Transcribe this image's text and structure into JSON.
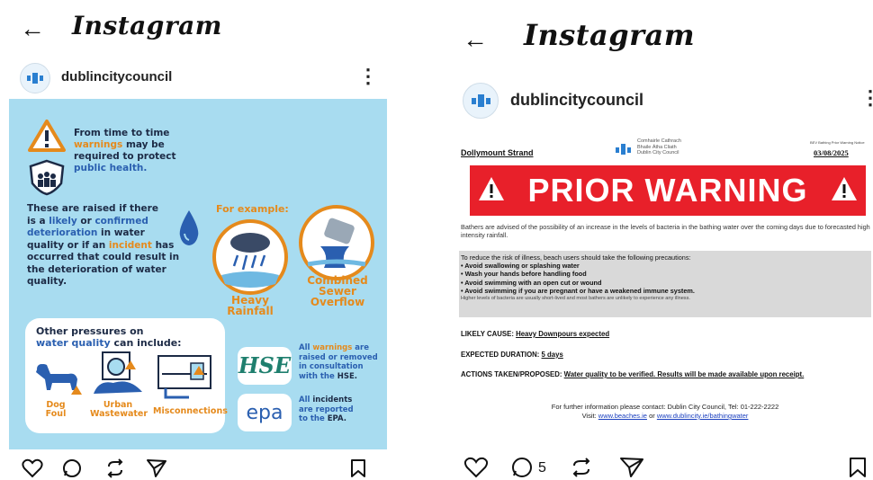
{
  "left": {
    "header": {
      "title": "Instagram"
    },
    "account": {
      "username": "dublincitycouncil"
    },
    "infographic": {
      "intro_a": "From time to time",
      "intro_warnings": "warnings",
      "intro_b": "may be",
      "intro_c": "required to protect",
      "intro_health": "public health.",
      "raised_1": "These are raised if there",
      "raised_2a": "is a",
      "raised_likely": "likely",
      "raised_or": "or",
      "raised_confirmed": "confirmed",
      "raised_deterioration": "deterioration",
      "raised_3b": "in water",
      "raised_4a": "quality or if an",
      "raised_incident": "incident",
      "raised_4b": "has",
      "raised_5": "occurred that could result in",
      "raised_6": "the deterioration of water",
      "raised_7": "quality.",
      "for_example": "For example:",
      "heavy_1": "Heavy",
      "heavy_2": "Rainfall",
      "sewer_1": "Combined",
      "sewer_2": "Sewer",
      "sewer_3": "Overflow",
      "other_1": "Other pressures on",
      "other_water": "water quality",
      "other_2": "can include:",
      "dog_1": "Dog",
      "dog_2": "Foul",
      "urban_1": "Urban",
      "urban_2": "Wastewater",
      "misconn": "Misconnections",
      "hse_logo": "HSE",
      "hse_1": "All",
      "hse_warnings": "warnings",
      "hse_1b": "are",
      "hse_2": "raised or removed",
      "hse_3": "in consultation",
      "hse_4a": "with the",
      "hse_4b": "HSE.",
      "epa_logo": "epa",
      "epa_1": "All",
      "epa_incidents": "incidents",
      "epa_2": "are reported",
      "epa_3a": "to the",
      "epa_3b": "EPA."
    }
  },
  "right": {
    "header": {
      "title": "Instagram"
    },
    "account": {
      "username": "dublincitycouncil"
    },
    "notice": {
      "location": "Dollymount Strand",
      "council_1": "Comhairle Cathrach",
      "council_2": "Bhaile Átha Cliath",
      "council_3": "Dublin City Council",
      "doc_type": "BEV Bathing Prior Warning Notice",
      "date": "03/08/2025",
      "banner": "PRIOR WARNING",
      "advice": "Bathers are advised of the possibility of an increase in the levels of bacteria in the bathing water over the coming days due to forecasted high intensity rainfall.",
      "reduce_intro": "To reduce the risk of illness, beach users should take the following precautions:",
      "precautions": [
        "• Avoid swallowing or splashing water",
        "• Wash your hands before handling food",
        "• Avoid swimming with an open cut or wound",
        "• Avoid swimming if you are pregnant or have a weakened immune system."
      ],
      "bacteria_note": "Higher levels of bacteria are usually short-lived and most bathers are unlikely to experience any illness.",
      "cause_label": "LIKELY CAUSE:",
      "cause_value": "Heavy Downpours expected",
      "duration_label": "EXPECTED DURATION:",
      "duration_value": "5 days",
      "actions_label": "ACTIONS TAKEN/PROPOSED:",
      "actions_value": "Water quality to be verified. Results will be made available upon receipt.",
      "contact": "For further information please contact: Dublin City Council, Tel: 01-222-2222",
      "visit_label": "Visit:",
      "visit_link1": "www.beaches.ie",
      "visit_or": "or",
      "visit_link2": "www.dublincity.ie/bathingwater"
    },
    "comment_count": "5"
  },
  "colors": {
    "panel_blue": "#a8dcf0",
    "warning_red": "#e8202a",
    "accent_orange": "#e58a1c",
    "text_blue": "#2a5fb0"
  }
}
